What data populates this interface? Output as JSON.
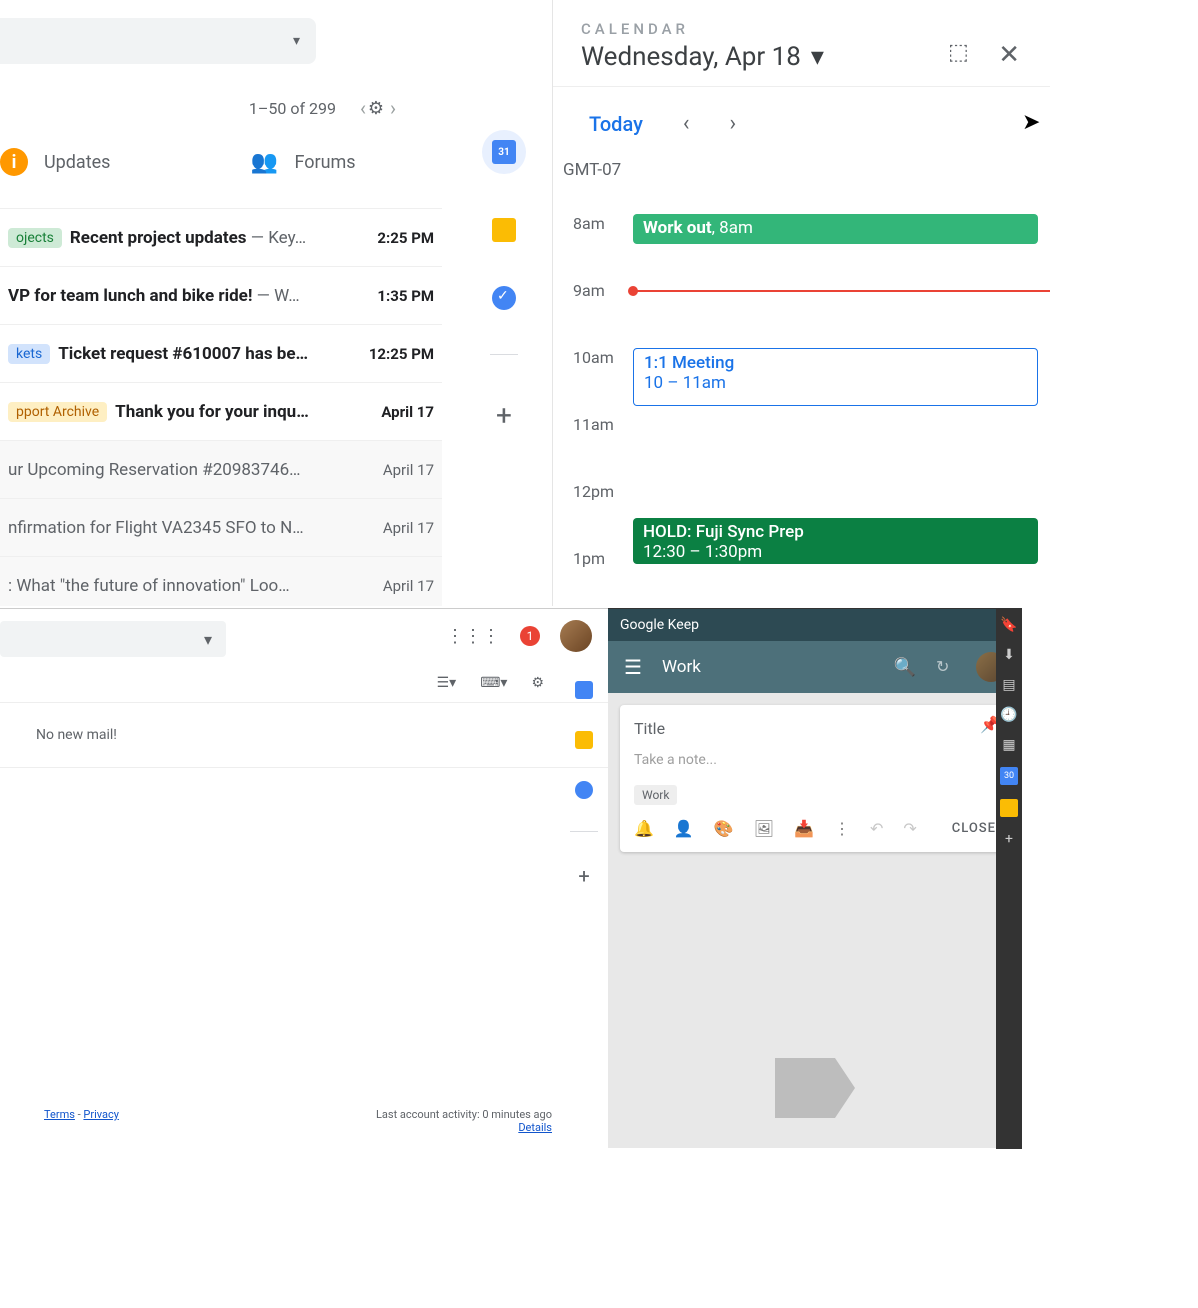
{
  "gmail_top": {
    "pager": "1–50 of 299",
    "tabs": {
      "updates": "Updates",
      "forums": "Forums"
    },
    "messages": [
      {
        "label": "ojects",
        "label_color": "green",
        "subject": "Recent project updates",
        "preview": " — Key…",
        "time": "2:25 PM",
        "unread": true
      },
      {
        "subject": "VP for team lunch and bike ride!",
        "preview": " — W…",
        "time": "1:35 PM",
        "unread": true
      },
      {
        "label": "kets",
        "label_color": "blue",
        "subject": "Ticket request #610007 has be…",
        "time": "12:25 PM",
        "unread": true
      },
      {
        "label": "pport Archive",
        "label_color": "orange",
        "subject": "Thank you for your inqu…",
        "time": "April 17",
        "unread": true
      },
      {
        "subject": "ur Upcoming Reservation #20983746…",
        "time": "April 17",
        "unread": false
      },
      {
        "subject": "nfirmation for Flight VA2345 SFO to N…",
        "time": "April 17",
        "unread": false
      },
      {
        "subject": ": What \"the future of innovation\" Loo…",
        "time": "April 17",
        "unread": false
      }
    ]
  },
  "side_icons": {
    "cal_day": "31"
  },
  "calendar": {
    "title": "CALENDAR",
    "date": "Wednesday, Apr 18",
    "today": "Today",
    "tz": "GMT-07",
    "hours": [
      "8am",
      "9am",
      "10am",
      "11am",
      "12pm",
      "1pm"
    ],
    "events": {
      "workout": {
        "title": "Work out",
        "sub": ", 8am"
      },
      "meeting": {
        "title": "1:1 Meeting",
        "sub": "10 – 11am"
      },
      "hold": {
        "title": "HOLD: Fuji Sync Prep",
        "sub": "12:30 – 1:30pm"
      }
    }
  },
  "gmail_bot": {
    "badge": "1",
    "nomail": "No new mail!",
    "terms": "Terms",
    "dash": " - ",
    "privacy": "Privacy",
    "activity": "Last account activity: 0 minutes ago",
    "details": "Details"
  },
  "keep": {
    "app": "Google Keep",
    "section": "Work",
    "note": {
      "title_ph": "Title",
      "body_ph": "Take a note...",
      "tag": "Work",
      "close": "CLOSE"
    },
    "rail_cal": "30"
  }
}
